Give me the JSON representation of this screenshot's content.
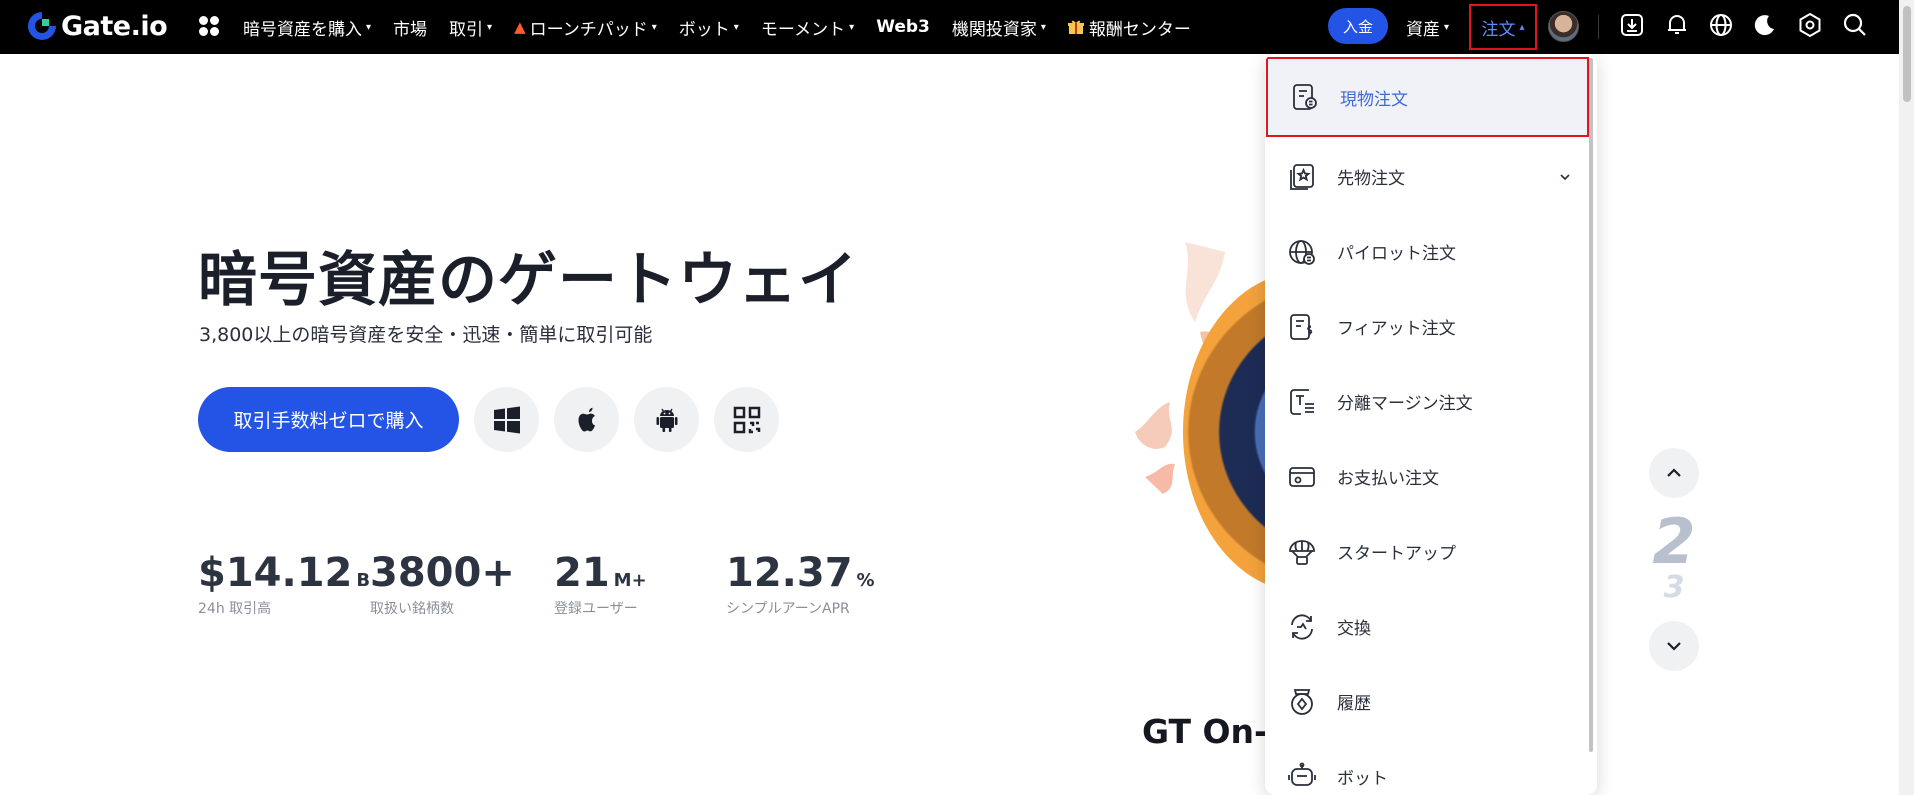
{
  "nav": {
    "logo_text": "Gate.io",
    "items": [
      {
        "label": "暗号資産を購入",
        "caret": "▾"
      },
      {
        "label": "市場",
        "caret": ""
      },
      {
        "label": "取引",
        "caret": "▾"
      },
      {
        "label": "ローンチパッド",
        "caret": "▾"
      },
      {
        "label": "ボット",
        "caret": "▾"
      },
      {
        "label": "モーメント",
        "caret": "▾"
      },
      {
        "label": "Web3",
        "caret": ""
      },
      {
        "label": "機関投資家",
        "caret": "▾"
      },
      {
        "label": "報酬センター",
        "caret": ""
      }
    ],
    "deposit_label": "入金",
    "assets_label": "資産",
    "assets_caret": "▾",
    "orders_label": "注文",
    "orders_caret": "▴",
    "accent_color": "#2354e6",
    "active_color": "#5b8dff",
    "icons": [
      "download-icon",
      "bell-icon",
      "globe-icon",
      "moon-icon",
      "settings-icon",
      "search-icon"
    ]
  },
  "hero": {
    "title": "暗号資産のゲートウェイ",
    "subtitle": "3,800以上の暗号資産を安全・迅速・簡単に取引可能",
    "cta_label": "取引手数料ゼロで購入",
    "platforms": [
      "windows-icon",
      "apple-icon",
      "android-icon",
      "qr-code-icon"
    ],
    "stats": [
      {
        "value": "$14.12",
        "unit": "B",
        "label": "24h 取引高"
      },
      {
        "value": "3800+",
        "unit": "",
        "label": "取扱い銘柄数"
      },
      {
        "value": "21",
        "unit": "M+",
        "label": "登録ユーザー"
      },
      {
        "value": "12.37",
        "unit": "%",
        "label": "シンプルアーンAPR"
      }
    ],
    "promo_heading": "GT On-"
  },
  "carousel": {
    "current": "2",
    "next": "3"
  },
  "orders_dropdown": {
    "items": [
      {
        "label": "現物注文",
        "icon": "spot-order-icon",
        "active": true
      },
      {
        "label": "先物注文",
        "icon": "futures-order-icon",
        "expandable": true
      },
      {
        "label": "パイロット注文",
        "icon": "pilot-order-icon"
      },
      {
        "label": "フィアット注文",
        "icon": "fiat-order-icon"
      },
      {
        "label": "分離マージン注文",
        "icon": "isolated-margin-icon"
      },
      {
        "label": "お支払い注文",
        "icon": "payment-order-icon"
      },
      {
        "label": "スタートアップ",
        "icon": "startup-icon"
      },
      {
        "label": "交換",
        "icon": "exchange-icon"
      },
      {
        "label": "履歴",
        "icon": "history-icon"
      },
      {
        "label": "ボット",
        "icon": "bot-icon"
      }
    ]
  }
}
